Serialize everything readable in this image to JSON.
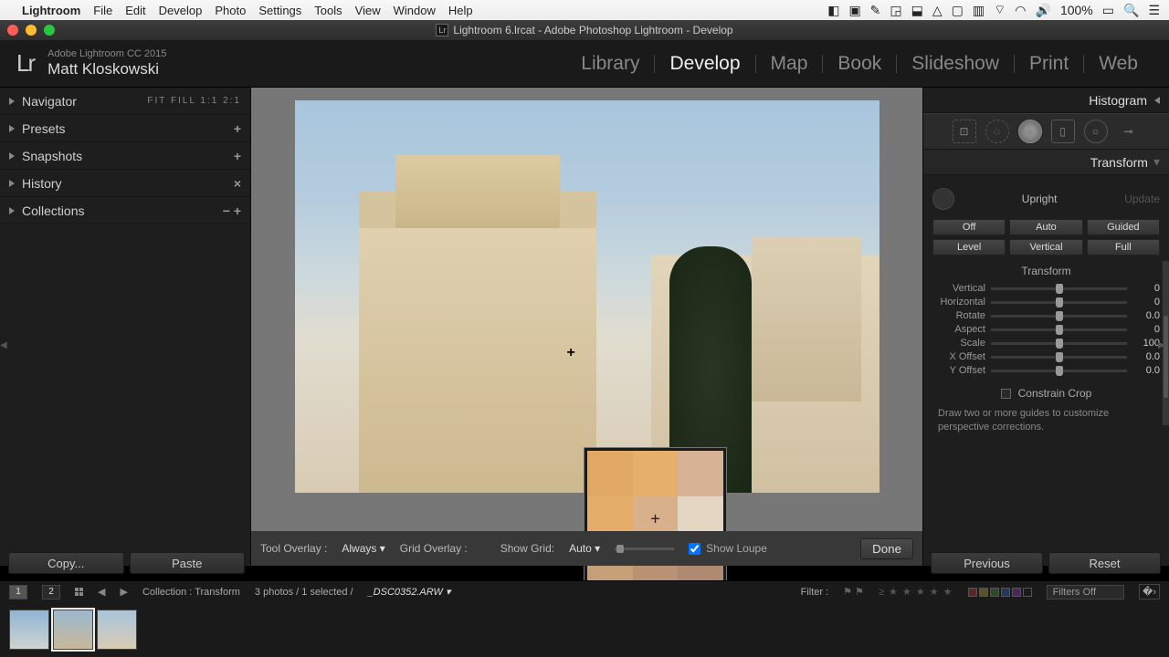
{
  "mac": {
    "app": "Lightroom",
    "menus": [
      "File",
      "Edit",
      "Develop",
      "Photo",
      "Settings",
      "Tools",
      "View",
      "Window",
      "Help"
    ],
    "battery": "100%",
    "apple_icon": "apple-icon"
  },
  "window": {
    "title": "Lightroom 6.lrcat - Adobe Photoshop Lightroom - Develop"
  },
  "identity": {
    "brand": "Adobe Lightroom CC 2015",
    "user": "Matt Kloskowski",
    "logo": "Lr"
  },
  "modules": [
    "Library",
    "Develop",
    "Map",
    "Book",
    "Slideshow",
    "Print",
    "Web"
  ],
  "active_module": "Develop",
  "left_panels": {
    "navigator": {
      "label": "Navigator",
      "modes": "FIT   FILL   1:1   2:1"
    },
    "items": [
      {
        "label": "Presets",
        "action": "+"
      },
      {
        "label": "Snapshots",
        "action": "+"
      },
      {
        "label": "History",
        "action": "×"
      },
      {
        "label": "Collections",
        "action": "−  +"
      }
    ]
  },
  "tool_opts": {
    "overlay_label": "Tool Overlay :",
    "overlay_value": "Always",
    "grid_label": "Grid Overlay :",
    "showgrid_label": "Show Grid:",
    "showgrid_value": "Auto",
    "loupe_label": "Show Loupe",
    "done": "Done"
  },
  "right": {
    "histogram": "Histogram",
    "transform_head": "Transform",
    "upright": "Upright",
    "update": "Update",
    "buttons_row1": [
      "Off",
      "Auto",
      "Guided"
    ],
    "buttons_row2": [
      "Level",
      "Vertical",
      "Full"
    ],
    "sub": "Transform",
    "sliders": [
      {
        "name": "Vertical",
        "val": "0"
      },
      {
        "name": "Horizontal",
        "val": "0"
      },
      {
        "name": "Rotate",
        "val": "0.0"
      },
      {
        "name": "Aspect",
        "val": "0"
      },
      {
        "name": "Scale",
        "val": "100"
      },
      {
        "name": "X Offset",
        "val": "0.0"
      },
      {
        "name": "Y Offset",
        "val": "0.0"
      }
    ],
    "constrain": "Constrain Crop",
    "help": "Draw two or more guides to customize perspective corrections."
  },
  "buttons": {
    "copy": "Copy...",
    "paste": "Paste",
    "previous": "Previous",
    "reset": "Reset"
  },
  "filterbar": {
    "pages": [
      "1",
      "2"
    ],
    "collection": "Collection : Transform",
    "count": "3 photos / 1 selected /",
    "file": "_DSC0352.ARW",
    "filter_label": "Filter :",
    "filters_off": "Filters Off"
  }
}
